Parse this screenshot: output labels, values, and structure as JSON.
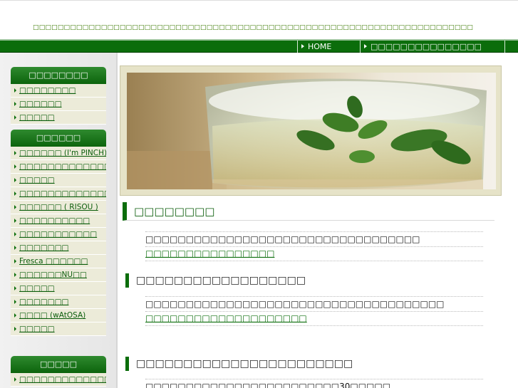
{
  "header": {
    "tagline": "□□□□□□□□□□□□□□□□□□□□□□□□□□□□□□□□□□□□□□□□□□□□□□□□□□□□□□□□□□□□□□□□□□□□□□□"
  },
  "nav": {
    "home_label": "HOME",
    "concept_label": "□□□□□□□□□□□□□□□"
  },
  "sidebar": {
    "sections": [
      {
        "title": "□□□□□□□□",
        "items": [
          "□□□□□□□□",
          "□□□□□□",
          "□□□□□"
        ]
      },
      {
        "title": "□□□□□□",
        "items": [
          "□□□□□□ (I'm PINCH)",
          "□□□□□□□□□□□□□□",
          "□□□□□",
          "□□□□□□□□□□□□□□□□",
          "□□□□□□ ( RISOU )",
          "□□□□□□□□□□",
          "□□□□□□□□□□□",
          "□□□□□□□",
          "Fresca □□□□□□",
          "□□□□□□NU□□",
          "□□□□□",
          "□□□□□□□",
          "□□□□ (wAtOSA)",
          "□□□□□"
        ]
      },
      {
        "title": "□□□□□",
        "items": [
          "□□□□□□□□□□□□□□□□□□"
        ]
      }
    ]
  },
  "main": {
    "hero_alt": "",
    "section1": {
      "title": "□□□□□□□□",
      "text": "□□□□□□□□□□□□□□□□□□□□□□□□□□□□□□□□□□",
      "link": "□□□□□□□□□□□□□□□□"
    },
    "section2": {
      "title": "□□□□□□□□□□□□□□□□□□",
      "text": "□□□□□□□□□□□□□□□□□□□□□□□□□□□□□□□□□□□□□",
      "link": "□□□□□□□□□□□□□□□□□□□□"
    },
    "section3": {
      "title": "□□□□□□□□□□□□□□□□□□□□□□□",
      "text": "□□□□□□□□□□□□□□□□□□□□□□□□30□□□□□"
    }
  },
  "colors": {
    "brand_green": "#0b6d0b",
    "sidebar_item_bg": "#ecebd9",
    "hero_frame": "#e6e3c8"
  },
  "icons": [
    "arrow-right-icon"
  ]
}
